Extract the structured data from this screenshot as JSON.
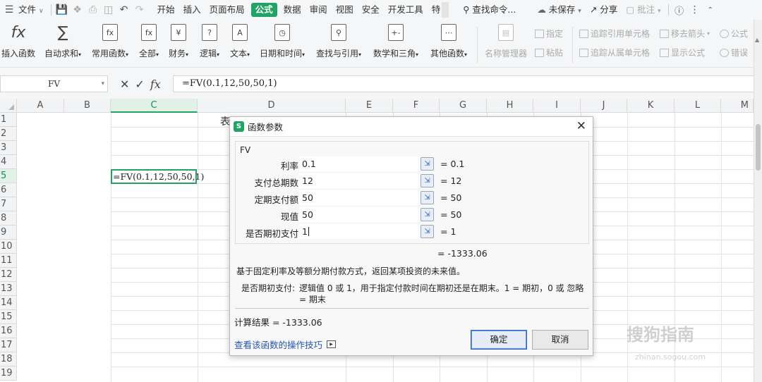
{
  "menu": {
    "file_label": "文件",
    "tabs": [
      "开始",
      "插入",
      "页面布局",
      "公式",
      "数据",
      "审阅",
      "视图",
      "安全",
      "开发工具",
      "特"
    ],
    "active_tab": "公式",
    "search_label": "查找命令...",
    "unsaved_label": "未保存",
    "share_label": "分享",
    "review_label": "批注"
  },
  "ribbon": {
    "buttons": [
      "插入函数",
      "自动求和",
      "常用函数",
      "全部",
      "财务",
      "逻辑",
      "文本",
      "日期和时间",
      "查找与引用",
      "数学和三角",
      "其他函数"
    ],
    "name_manager": "名称管理器",
    "define": "指定",
    "paste": "粘贴",
    "trace_precedents": "追踪引用单元格",
    "trace_dependents": "追踪从属单元格",
    "remove_arrows": "移去箭头",
    "show_formulas": "显示公式",
    "formula": "公式",
    "error": "错误"
  },
  "formula_bar": {
    "name_box": "FV",
    "formula": "=FV(0.1,12,50,50,1)"
  },
  "grid": {
    "columns": [
      "A",
      "B",
      "C",
      "D",
      "E",
      "F",
      "G",
      "H",
      "I",
      "J",
      "K",
      "L",
      "M"
    ],
    "active_column": "C",
    "rows": [
      "1",
      "2",
      "3",
      "4",
      "5",
      "6",
      "7",
      "8",
      "9",
      "10",
      "11",
      "12",
      "13",
      "14",
      "15",
      "16",
      "17",
      "18",
      "19"
    ],
    "active_row": "5",
    "c5_text": "=FV(0.1,12,50,50,1)",
    "d1_text": "表"
  },
  "dialog": {
    "title": "函数参数",
    "function_name": "FV",
    "args": [
      {
        "label": "利率",
        "value": "0.1",
        "result": "= 0.1"
      },
      {
        "label": "支付总期数",
        "value": "12",
        "result": "= 12"
      },
      {
        "label": "定期支付额",
        "value": "50",
        "result": "= 50"
      },
      {
        "label": "现值",
        "value": "50",
        "result": "= 50"
      },
      {
        "label": "是否期初支付",
        "value": "1",
        "result": "= 1"
      }
    ],
    "total_result": "= -1333.06",
    "description": "基于固定利率及等额分期付款方式，返回某项投资的未来值。",
    "param_name": "是否期初支付:",
    "param_desc": "逻辑值 0 或 1，用于指定付款时间在期初还是在期末。1 = 期初，0 或 忽略 = 期末",
    "calc_result": "计算结果 = -1333.06",
    "help_link": "查看该函数的操作技巧",
    "ok_label": "确定",
    "cancel_label": "取消"
  },
  "watermark": {
    "text": "搜狗指南",
    "url": "zhinan.sogou.com"
  },
  "colors": {
    "accent": "#21a366",
    "link": "#2356b3"
  }
}
